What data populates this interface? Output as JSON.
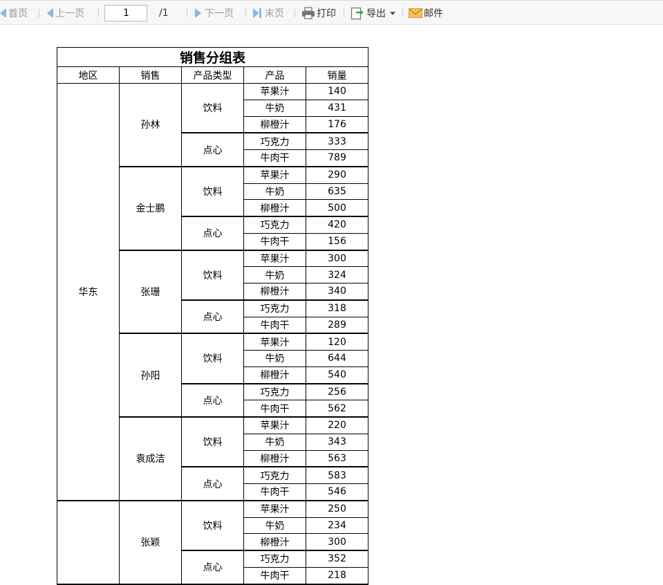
{
  "toolbar": {
    "first_label": "首页",
    "prev_label": "上一页",
    "current_page": "1",
    "total_pages": "/1",
    "next_label": "下一页",
    "last_label": "末页",
    "print_label": "打印",
    "export_label": "导出",
    "mail_label": "邮件"
  },
  "report": {
    "title": "销售分组表",
    "headers": [
      "地区",
      "销售",
      "产品类型",
      "产品",
      "销量"
    ],
    "regions": [
      {
        "name": "华东",
        "reps": [
          {
            "name": "孙林",
            "groups": [
              {
                "type": "饮料",
                "items": [
                  {
                    "product": "苹果汁",
                    "sales": "140"
                  },
                  {
                    "product": "牛奶",
                    "sales": "431"
                  },
                  {
                    "product": "柳橙汁",
                    "sales": "176"
                  }
                ]
              },
              {
                "type": "点心",
                "items": [
                  {
                    "product": "巧克力",
                    "sales": "333"
                  },
                  {
                    "product": "牛肉干",
                    "sales": "789"
                  }
                ]
              }
            ]
          },
          {
            "name": "金士鹏",
            "groups": [
              {
                "type": "饮料",
                "items": [
                  {
                    "product": "苹果汁",
                    "sales": "290"
                  },
                  {
                    "product": "牛奶",
                    "sales": "635"
                  },
                  {
                    "product": "柳橙汁",
                    "sales": "500"
                  }
                ]
              },
              {
                "type": "点心",
                "items": [
                  {
                    "product": "巧克力",
                    "sales": "420"
                  },
                  {
                    "product": "牛肉干",
                    "sales": "156"
                  }
                ]
              }
            ]
          },
          {
            "name": "张珊",
            "groups": [
              {
                "type": "饮料",
                "items": [
                  {
                    "product": "苹果汁",
                    "sales": "300"
                  },
                  {
                    "product": "牛奶",
                    "sales": "324"
                  },
                  {
                    "product": "柳橙汁",
                    "sales": "340"
                  }
                ]
              },
              {
                "type": "点心",
                "items": [
                  {
                    "product": "巧克力",
                    "sales": "318"
                  },
                  {
                    "product": "牛肉干",
                    "sales": "289"
                  }
                ]
              }
            ]
          },
          {
            "name": "孙阳",
            "groups": [
              {
                "type": "饮料",
                "items": [
                  {
                    "product": "苹果汁",
                    "sales": "120"
                  },
                  {
                    "product": "牛奶",
                    "sales": "644"
                  },
                  {
                    "product": "柳橙汁",
                    "sales": "540"
                  }
                ]
              },
              {
                "type": "点心",
                "items": [
                  {
                    "product": "巧克力",
                    "sales": "256"
                  },
                  {
                    "product": "牛肉干",
                    "sales": "562"
                  }
                ]
              }
            ]
          },
          {
            "name": "袁成洁",
            "groups": [
              {
                "type": "饮料",
                "items": [
                  {
                    "product": "苹果汁",
                    "sales": "220"
                  },
                  {
                    "product": "牛奶",
                    "sales": "343"
                  },
                  {
                    "product": "柳橙汁",
                    "sales": "563"
                  }
                ]
              },
              {
                "type": "点心",
                "items": [
                  {
                    "product": "巧克力",
                    "sales": "583"
                  },
                  {
                    "product": "牛肉干",
                    "sales": "546"
                  }
                ]
              }
            ]
          }
        ]
      },
      {
        "name": "",
        "reps": [
          {
            "name": "张颖",
            "groups": [
              {
                "type": "饮料",
                "items": [
                  {
                    "product": "苹果汁",
                    "sales": "250"
                  },
                  {
                    "product": "牛奶",
                    "sales": "234"
                  },
                  {
                    "product": "柳橙汁",
                    "sales": "300"
                  }
                ]
              },
              {
                "type": "点心",
                "items": [
                  {
                    "product": "巧克力",
                    "sales": "352"
                  },
                  {
                    "product": "牛肉干",
                    "sales": "218"
                  }
                ]
              }
            ]
          }
        ]
      }
    ]
  }
}
